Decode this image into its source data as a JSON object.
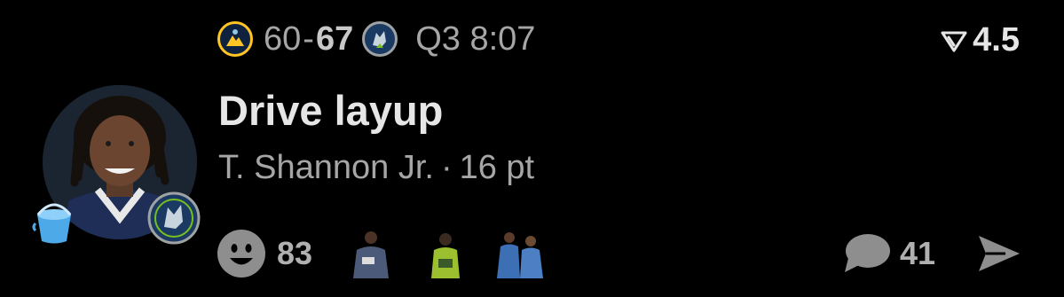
{
  "scoreboard": {
    "away_team_icon": "nuggets-logo-icon",
    "away_score": "60",
    "separator": "-",
    "home_score": "67",
    "home_team_icon": "timberwolves-logo-icon",
    "period_clock": "Q3 8:07",
    "odds_icon": "down-triangle-icon",
    "odds_value": "4.5",
    "colors": {
      "nuggets_navy": "#0e2240",
      "nuggets_gold": "#fec524",
      "wolves_blue": "#1a3a63",
      "wolves_green": "#78be20"
    }
  },
  "play": {
    "title": "Drive layup",
    "player": "T. Shannon Jr.",
    "separator": "·",
    "points": "16 pt",
    "avatar_icon": "player-headshot",
    "team_badge_icon": "timberwolves-logo-icon",
    "bucket_icon": "bucket-icon"
  },
  "reactions": {
    "emoji_icon": "smiley-face-icon",
    "count": "83",
    "stickers": [
      "player-sticker-1",
      "player-sticker-2",
      "player-sticker-3"
    ]
  },
  "comments": {
    "icon": "speech-bubble-icon",
    "count": "41",
    "share_icon": "send-arrow-icon"
  }
}
